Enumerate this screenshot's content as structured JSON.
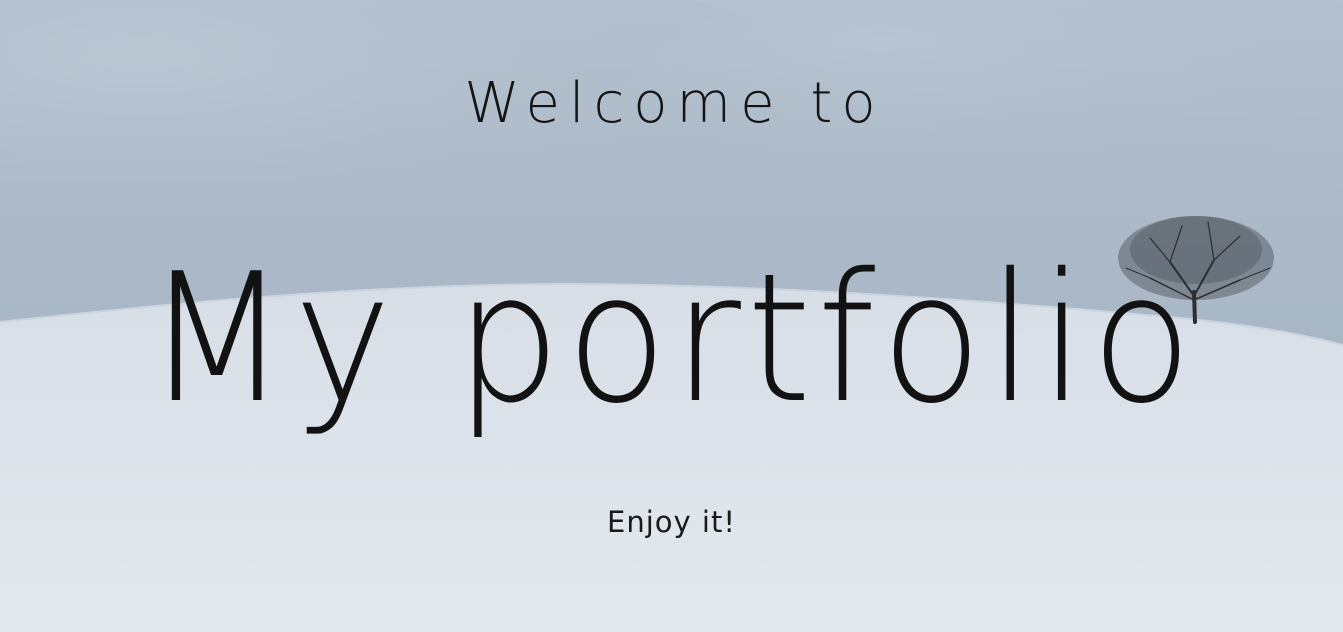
{
  "hero": {
    "welcome": "Welcome to",
    "title": "My portfolio",
    "subtitle": "Enjoy it!"
  },
  "colors": {
    "sky": "#aebccb",
    "snow": "#dfe5ec",
    "text": "#141414"
  }
}
